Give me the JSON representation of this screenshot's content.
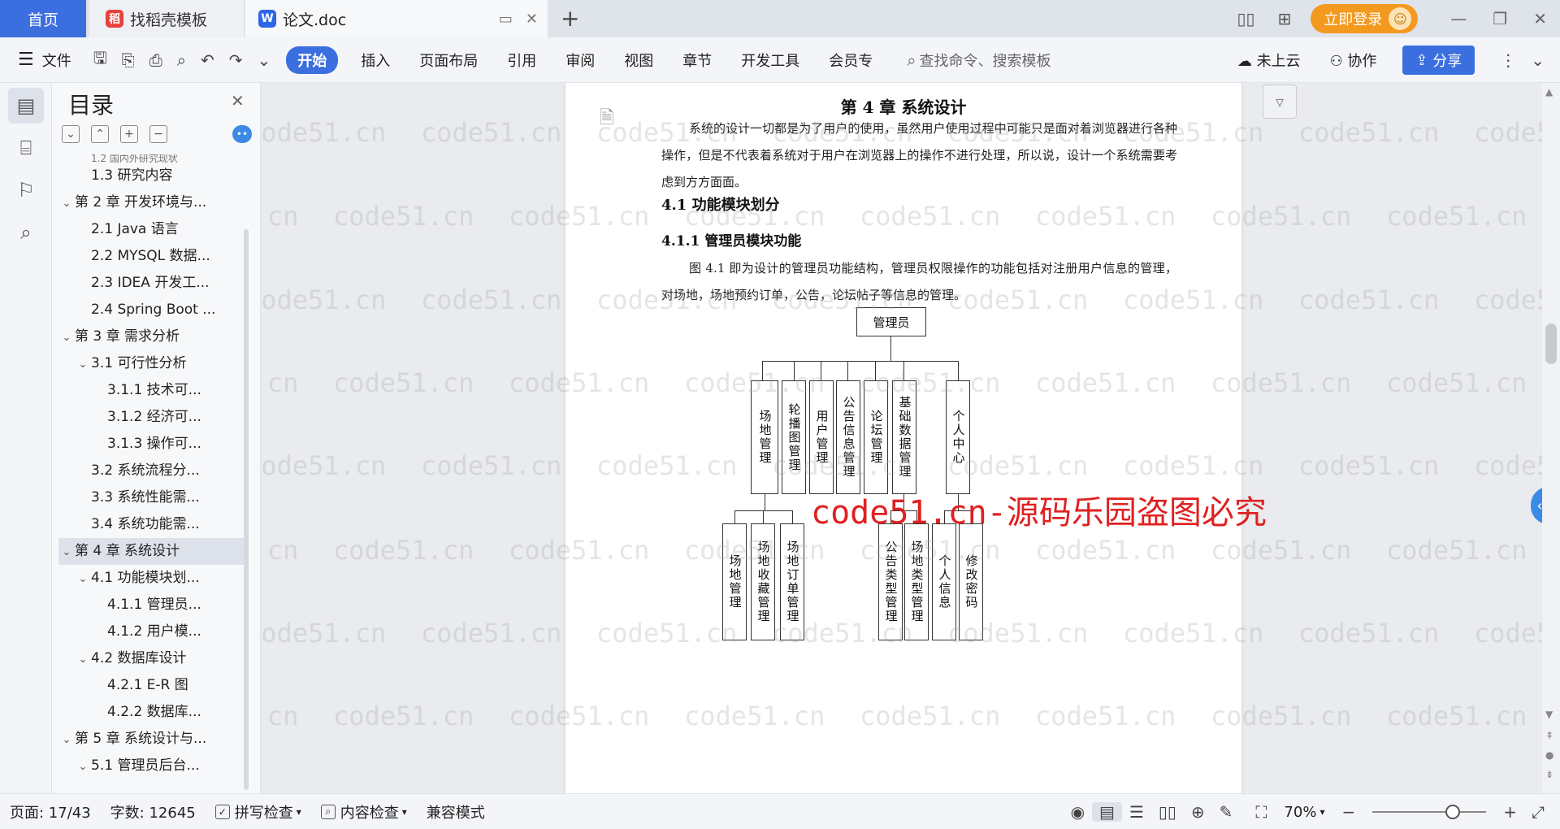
{
  "tabs": {
    "home": "首页",
    "template": "找稻壳模板",
    "doc": "论文.doc"
  },
  "titlebar": {
    "login": "立即登录"
  },
  "ribbon": {
    "file": "文件",
    "tabs": [
      "开始",
      "插入",
      "页面布局",
      "引用",
      "审阅",
      "视图",
      "章节",
      "开发工具",
      "会员专"
    ],
    "search_placeholder": "查找命令、搜索模板",
    "cloud": "未上云",
    "collab": "协作",
    "share": "分享"
  },
  "toc": {
    "title": "目录",
    "items": [
      {
        "label": "1.2 国内外研究现状",
        "level": 2,
        "caret": false
      },
      {
        "label": "1.3 研究内容",
        "level": 2,
        "caret": false
      },
      {
        "label": "第 2 章 开发环境与...",
        "level": 1,
        "caret": true
      },
      {
        "label": "2.1 Java 语言",
        "level": 2,
        "caret": false
      },
      {
        "label": "2.2 MYSQL 数据...",
        "level": 2,
        "caret": false
      },
      {
        "label": "2.3 IDEA 开发工...",
        "level": 2,
        "caret": false
      },
      {
        "label": "2.4 Spring Boot ...",
        "level": 2,
        "caret": false
      },
      {
        "label": "第 3 章 需求分析",
        "level": 1,
        "caret": true
      },
      {
        "label": "3.1 可行性分析",
        "level": 2,
        "caret": true
      },
      {
        "label": "3.1.1 技术可...",
        "level": 3,
        "caret": false
      },
      {
        "label": "3.1.2 经济可...",
        "level": 3,
        "caret": false
      },
      {
        "label": "3.1.3 操作可...",
        "level": 3,
        "caret": false
      },
      {
        "label": "3.2 系统流程分...",
        "level": 2,
        "caret": false
      },
      {
        "label": "3.3 系统性能需...",
        "level": 2,
        "caret": false
      },
      {
        "label": "3.4 系统功能需...",
        "level": 2,
        "caret": false
      },
      {
        "label": "第 4 章 系统设计",
        "level": 1,
        "caret": true,
        "selected": true
      },
      {
        "label": "4.1 功能模块划...",
        "level": 2,
        "caret": true
      },
      {
        "label": "4.1.1 管理员...",
        "level": 3,
        "caret": false
      },
      {
        "label": "4.1.2 用户模...",
        "level": 3,
        "caret": false
      },
      {
        "label": "4.2 数据库设计",
        "level": 2,
        "caret": true
      },
      {
        "label": "4.2.1 E-R 图",
        "level": 3,
        "caret": false
      },
      {
        "label": "4.2.2 数据库...",
        "level": 3,
        "caret": false
      },
      {
        "label": "第 5 章 系统设计与...",
        "level": 1,
        "caret": true
      },
      {
        "label": "5.1 管理员后台...",
        "level": 2,
        "caret": true
      }
    ]
  },
  "document": {
    "chapter_title": "第 4 章  系统设计",
    "intro": "系统的设计一切都是为了用户的使用，虽然用户使用过程中可能只是面对着浏览器进行各种操作，但是不代表着系统对于用户在浏览器上的操作不进行处理，所以说，设计一个系统需要考虑到方方面面。",
    "section": "4.1  功能模块划分",
    "subsection": "4.1.1  管理员模块功能",
    "para2": "图 4.1 即为设计的管理员功能结构，管理员权限操作的功能包括对注册用户信息的管理，对场地，场地预约订单，公告，论坛帖子等信息的管理。",
    "chart": {
      "root": "管理员",
      "level1": [
        "场地管理",
        "轮播图管理",
        "用户管理",
        "公告信息管理",
        "论坛管理",
        "基础数据管理",
        "个人中心"
      ],
      "level2_venue": [
        "场地管理",
        "场地收藏管理",
        "场地订单管理"
      ],
      "level2_base": [
        "公告类型管理",
        "场地类型管理"
      ],
      "level2_personal": [
        "个人信息",
        "修改密码"
      ]
    }
  },
  "watermark": {
    "text": "code51.cn",
    "piracy": "code51.cn-源码乐园盗图必究"
  },
  "status": {
    "page": "页面: 17/43",
    "words": "字数: 12645",
    "spell": "拼写检查",
    "content": "内容检查",
    "compat": "兼容模式",
    "zoom": "70%"
  }
}
